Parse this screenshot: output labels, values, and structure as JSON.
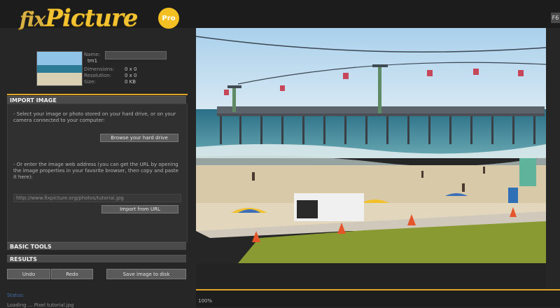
{
  "app": {
    "logo_text_prefix": "fix",
    "logo_text_main": "Picture",
    "logo_badge": "Pro",
    "corner_button": "F6"
  },
  "info": {
    "button_label": "",
    "rows": [
      {
        "label": "Name:",
        "value": "tm1"
      },
      {
        "label": "Dimensions:",
        "value": "0 x 0"
      },
      {
        "label": "Resolution:",
        "value": "0 x 0"
      },
      {
        "label": "Size:",
        "value": "0 KB"
      }
    ]
  },
  "import_section": {
    "header": "IMPORT IMAGE",
    "select_text": "- Select your image or photo stored on your hard drive, or on your camera connected to your computer:",
    "browse_button": "Browse your hard drive",
    "url_text": "- Or enter the image web address (you can get the URL by opening the image properties in your favorite browser, then copy and paste it here):",
    "url_value": "http://www.fixpicture.org/photos/tutorial.jpg",
    "import_url_button": "Import from URL"
  },
  "basic_tools_header": "BASIC TOOLS",
  "results_header": "RESULTS",
  "bottom_buttons": {
    "undo": "Undo",
    "redo": "Redo",
    "save": "Save image to disk"
  },
  "status": {
    "label": "Status:",
    "text": "Loading ... Pixel tutorial.jpg"
  },
  "zoom": {
    "label": "100%"
  },
  "colors": {
    "accent": "#e0a528",
    "panel": "#303030",
    "header": "#4a4a4a"
  }
}
